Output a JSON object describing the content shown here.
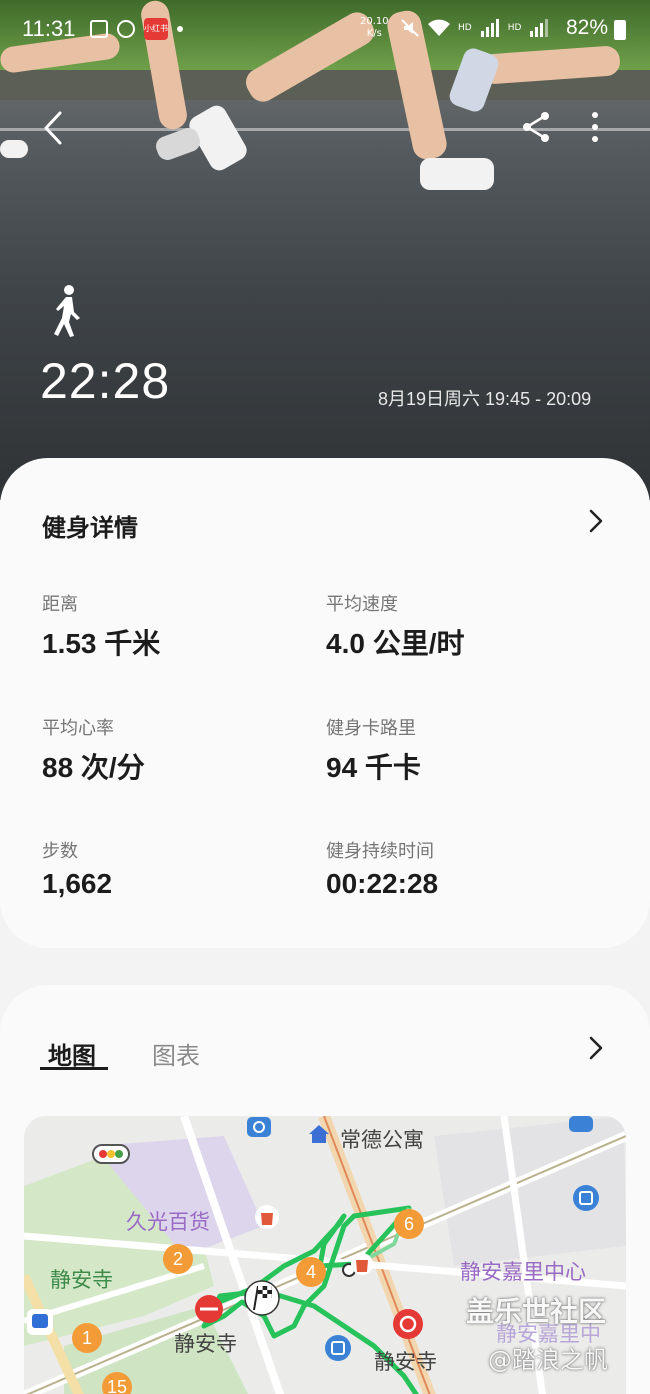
{
  "status_bar": {
    "time": "11:31",
    "net_speed_value": "20.10",
    "net_speed_unit": "K/s",
    "battery": "82%",
    "app_badge": "小红书"
  },
  "hero": {
    "activity_icon": "walk-icon",
    "duration": "22:28",
    "date_range": "8月19日周六 19:45 - 20:09"
  },
  "details": {
    "title": "健身详情",
    "stats": [
      {
        "label": "距离",
        "value": "1.53 千米"
      },
      {
        "label": "平均速度",
        "value": "4.0 公里/时"
      },
      {
        "label": "平均心率",
        "value": "88 次/分"
      },
      {
        "label": "健身卡路里",
        "value": "94 千卡"
      },
      {
        "label": "步数",
        "value": "1,662"
      },
      {
        "label": "健身持续时间",
        "value": "00:22:28"
      }
    ]
  },
  "map_section": {
    "tabs": [
      "地图",
      "图表"
    ],
    "active_tab": "地图",
    "labels": {
      "changde": "常德公寓",
      "jiuguang": "久光百货",
      "jingansi_green": "静安寺",
      "jingansi_station1": "静安寺",
      "jingansi_station2": "静安寺",
      "kerry": "静安嘉里中心",
      "kerry2": "静安嘉里中"
    },
    "markers": [
      "2",
      "4",
      "6",
      "1",
      "15"
    ],
    "route_color": "#27c35a"
  },
  "watermark": {
    "line1": "盖乐世社区",
    "line2": "@踏浪之帆"
  }
}
